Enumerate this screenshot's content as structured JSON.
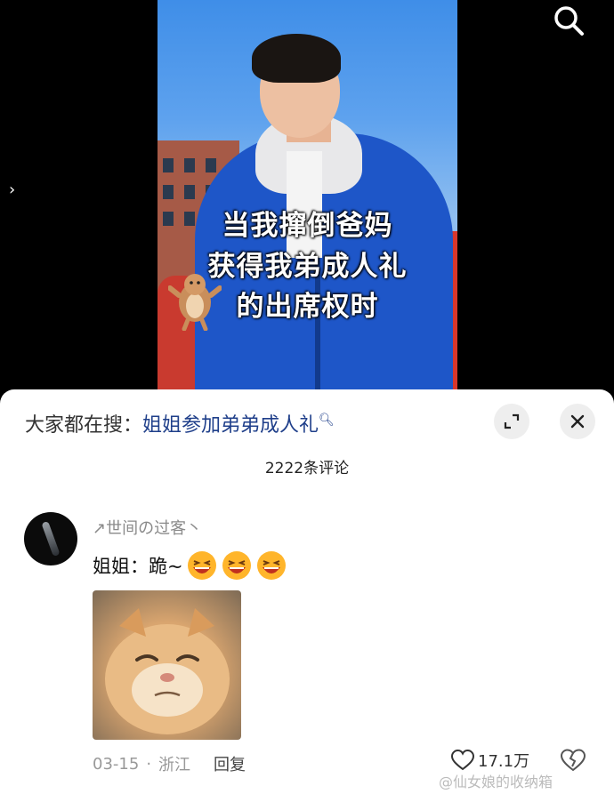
{
  "video": {
    "overlay_lines": [
      "当我撺倒爸妈",
      "获得我弟成人礼",
      "的出席权时"
    ]
  },
  "panel": {
    "search_label": "大家都在搜：",
    "search_query": "姐姐参加弟弟成人礼",
    "comment_count": "2222条评论"
  },
  "comment": {
    "username": "↗世间の过客丶",
    "text": "姐姐：跪~",
    "date": "03-15",
    "location": "浙江",
    "reply_label": "回复",
    "likes": "17.1万"
  },
  "watermark": "@仙女娘的收纳箱",
  "icons": {
    "search": "search-icon",
    "arrow": "chevron-right-icon",
    "expand": "expand-icon",
    "close": "close-icon",
    "like": "heart-icon",
    "dislike": "broken-heart-icon",
    "emoji": "laughing-emoji-icon"
  }
}
